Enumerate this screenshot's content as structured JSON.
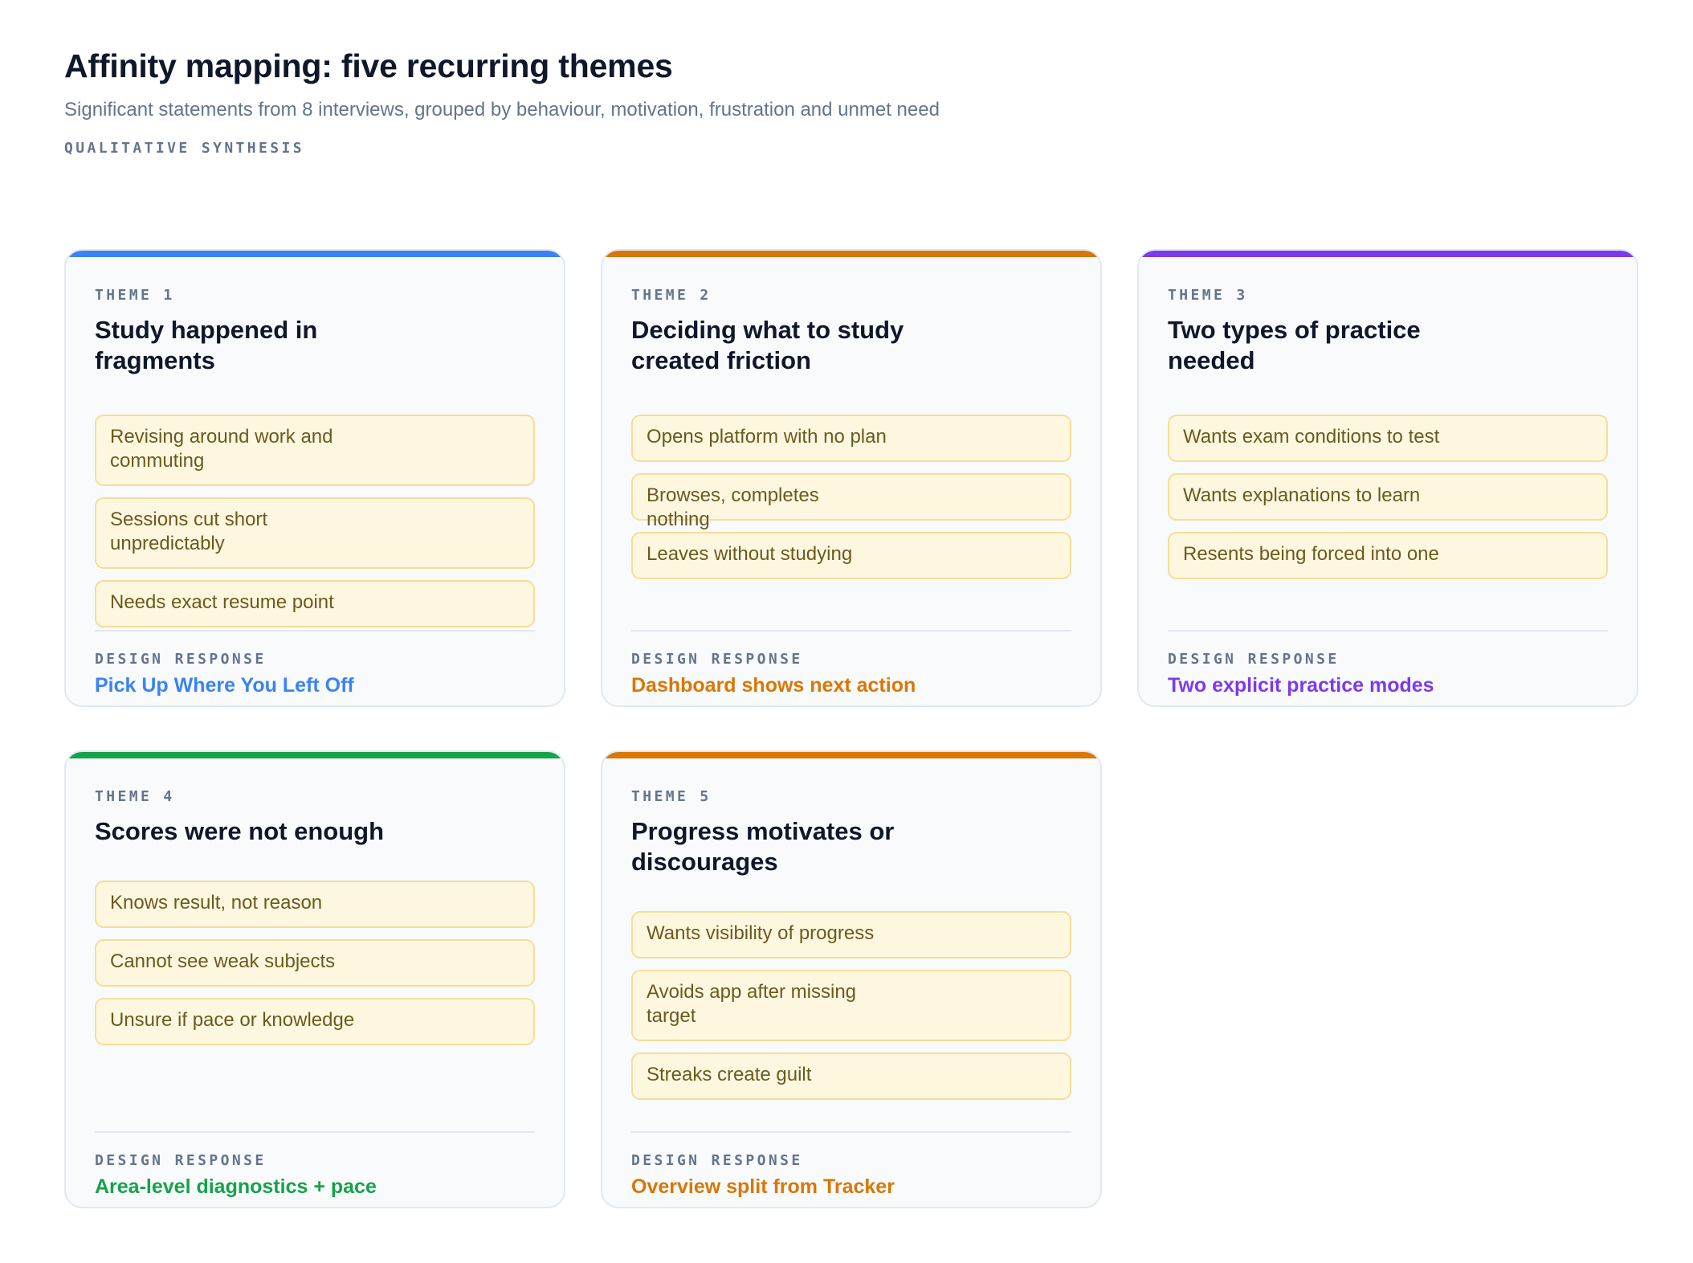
{
  "header": {
    "title": "Affinity mapping: five recurring themes",
    "subtitle": "Significant statements from 8 interviews, grouped by behaviour, motivation, frustration and unmet need",
    "eyebrow": "QUALITATIVE SYNTHESIS"
  },
  "response_label": "DESIGN RESPONSE",
  "themes": [
    {
      "label": "THEME 1",
      "title": "Study happened in fragments",
      "accent": "#3b82f6",
      "statements": [
        "Revising around work and commuting",
        "Sessions cut short unpredictably",
        "Needs exact resume point"
      ],
      "response": "Pick Up Where You Left Off"
    },
    {
      "label": "THEME 2",
      "title": "Deciding what to study created friction",
      "accent": "#d97706",
      "statements": [
        "Opens platform with no plan",
        "Browses, completes nothing",
        "Leaves without studying"
      ],
      "response": "Dashboard shows next action"
    },
    {
      "label": "THEME 3",
      "title": "Two types of practice needed",
      "accent": "#7c3aed",
      "statements": [
        "Wants exam conditions to test",
        "Wants explanations to learn",
        "Resents being forced into one"
      ],
      "response": "Two explicit practice modes"
    },
    {
      "label": "THEME 4",
      "title": "Scores were not enough",
      "accent": "#16a34a",
      "statements": [
        "Knows result, not reason",
        "Cannot see weak subjects",
        "Unsure if pace or knowledge"
      ],
      "response": "Area-level diagnostics + pace"
    },
    {
      "label": "THEME 5",
      "title": "Progress motivates or discourages",
      "accent": "#d97706",
      "statements": [
        "Wants visibility of progress",
        "Avoids app after missing target",
        "Streaks create guilt"
      ],
      "response": "Overview split from Tracker"
    }
  ]
}
